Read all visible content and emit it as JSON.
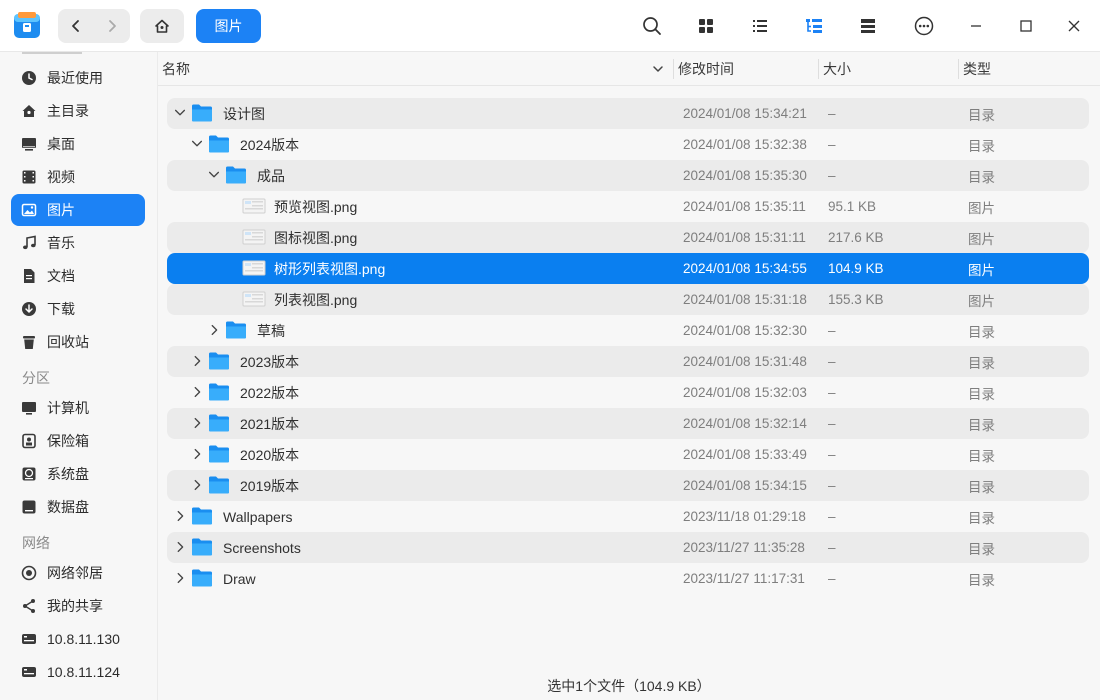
{
  "toolbar": {
    "breadcrumb": "图片"
  },
  "sidebar": {
    "items_quick": [
      {
        "label": "最近使用",
        "icon": "clock-icon"
      },
      {
        "label": "主目录",
        "icon": "home-icon"
      },
      {
        "label": "桌面",
        "icon": "desktop-icon"
      },
      {
        "label": "视频",
        "icon": "video-icon"
      },
      {
        "label": "图片",
        "icon": "image-icon",
        "active": true
      },
      {
        "label": "音乐",
        "icon": "music-icon"
      },
      {
        "label": "文档",
        "icon": "document-icon"
      },
      {
        "label": "下载",
        "icon": "download-icon"
      },
      {
        "label": "回收站",
        "icon": "trash-icon"
      }
    ],
    "group_partitions": "分区",
    "items_partitions": [
      {
        "label": "计算机",
        "icon": "computer-icon"
      },
      {
        "label": "保险箱",
        "icon": "vault-icon"
      },
      {
        "label": "系统盘",
        "icon": "system-disk-icon"
      },
      {
        "label": "数据盘",
        "icon": "data-disk-icon"
      }
    ],
    "group_network": "网络",
    "items_network": [
      {
        "label": "网络邻居",
        "icon": "network-neighborhood-icon"
      },
      {
        "label": "我的共享",
        "icon": "share-icon"
      },
      {
        "label": "10.8.11.130",
        "icon": "network-drive-icon"
      },
      {
        "label": "10.8.11.124",
        "icon": "network-drive-icon"
      }
    ]
  },
  "columns": {
    "name": "名称",
    "modified": "修改时间",
    "size": "大小",
    "type": "类型"
  },
  "rows": [
    {
      "name": "设计图",
      "date": "2024/01/08  15:34:21",
      "size": "–",
      "type": "目录",
      "kind": "folder",
      "expanded": true
    },
    {
      "name": "2024版本",
      "date": "2024/01/08  15:32:38",
      "size": "–",
      "type": "目录",
      "kind": "folder",
      "expanded": true
    },
    {
      "name": "成品",
      "date": "2024/01/08  15:35:30",
      "size": "–",
      "type": "目录",
      "kind": "folder",
      "expanded": true
    },
    {
      "name": "预览视图.png",
      "date": "2024/01/08  15:35:11",
      "size": "95.1  KB",
      "type": "图片",
      "kind": "image"
    },
    {
      "name": "图标视图.png",
      "date": "2024/01/08  15:31:11",
      "size": "217.6  KB",
      "type": "图片",
      "kind": "image"
    },
    {
      "name": "树形列表视图.png",
      "date": "2024/01/08  15:34:55",
      "size": "104.9  KB",
      "type": "图片",
      "kind": "image",
      "selected": true
    },
    {
      "name": "列表视图.png",
      "date": "2024/01/08  15:31:18",
      "size": "155.3  KB",
      "type": "图片",
      "kind": "image"
    },
    {
      "name": "草稿",
      "date": "2024/01/08  15:32:30",
      "size": "–",
      "type": "目录",
      "kind": "folder",
      "expanded": false
    },
    {
      "name": "2023版本",
      "date": "2024/01/08  15:31:48",
      "size": "–",
      "type": "目录",
      "kind": "folder",
      "expanded": false
    },
    {
      "name": "2022版本",
      "date": "2024/01/08  15:32:03",
      "size": "–",
      "type": "目录",
      "kind": "folder",
      "expanded": false
    },
    {
      "name": "2021版本",
      "date": "2024/01/08  15:32:14",
      "size": "–",
      "type": "目录",
      "kind": "folder",
      "expanded": false
    },
    {
      "name": "2020版本",
      "date": "2024/01/08  15:33:49",
      "size": "–",
      "type": "目录",
      "kind": "folder",
      "expanded": false
    },
    {
      "name": "2019版本",
      "date": "2024/01/08  15:34:15",
      "size": "–",
      "type": "目录",
      "kind": "folder",
      "expanded": false
    },
    {
      "name": "Wallpapers",
      "date": "2023/11/18  01:29:18",
      "size": "–",
      "type": "目录",
      "kind": "folder",
      "expanded": false
    },
    {
      "name": "Screenshots",
      "date": "2023/11/27  11:35:28",
      "size": "–",
      "type": "目录",
      "kind": "folder",
      "expanded": false
    },
    {
      "name": "Draw",
      "date": "2023/11/27  11:17:31",
      "size": "–",
      "type": "目录",
      "kind": "folder",
      "expanded": false
    }
  ],
  "status": "选中1个文件（104.9  KB）",
  "colors": {
    "accent": "#1c82f5",
    "selection": "#0a7ff0",
    "folder": "#2a9df4"
  }
}
